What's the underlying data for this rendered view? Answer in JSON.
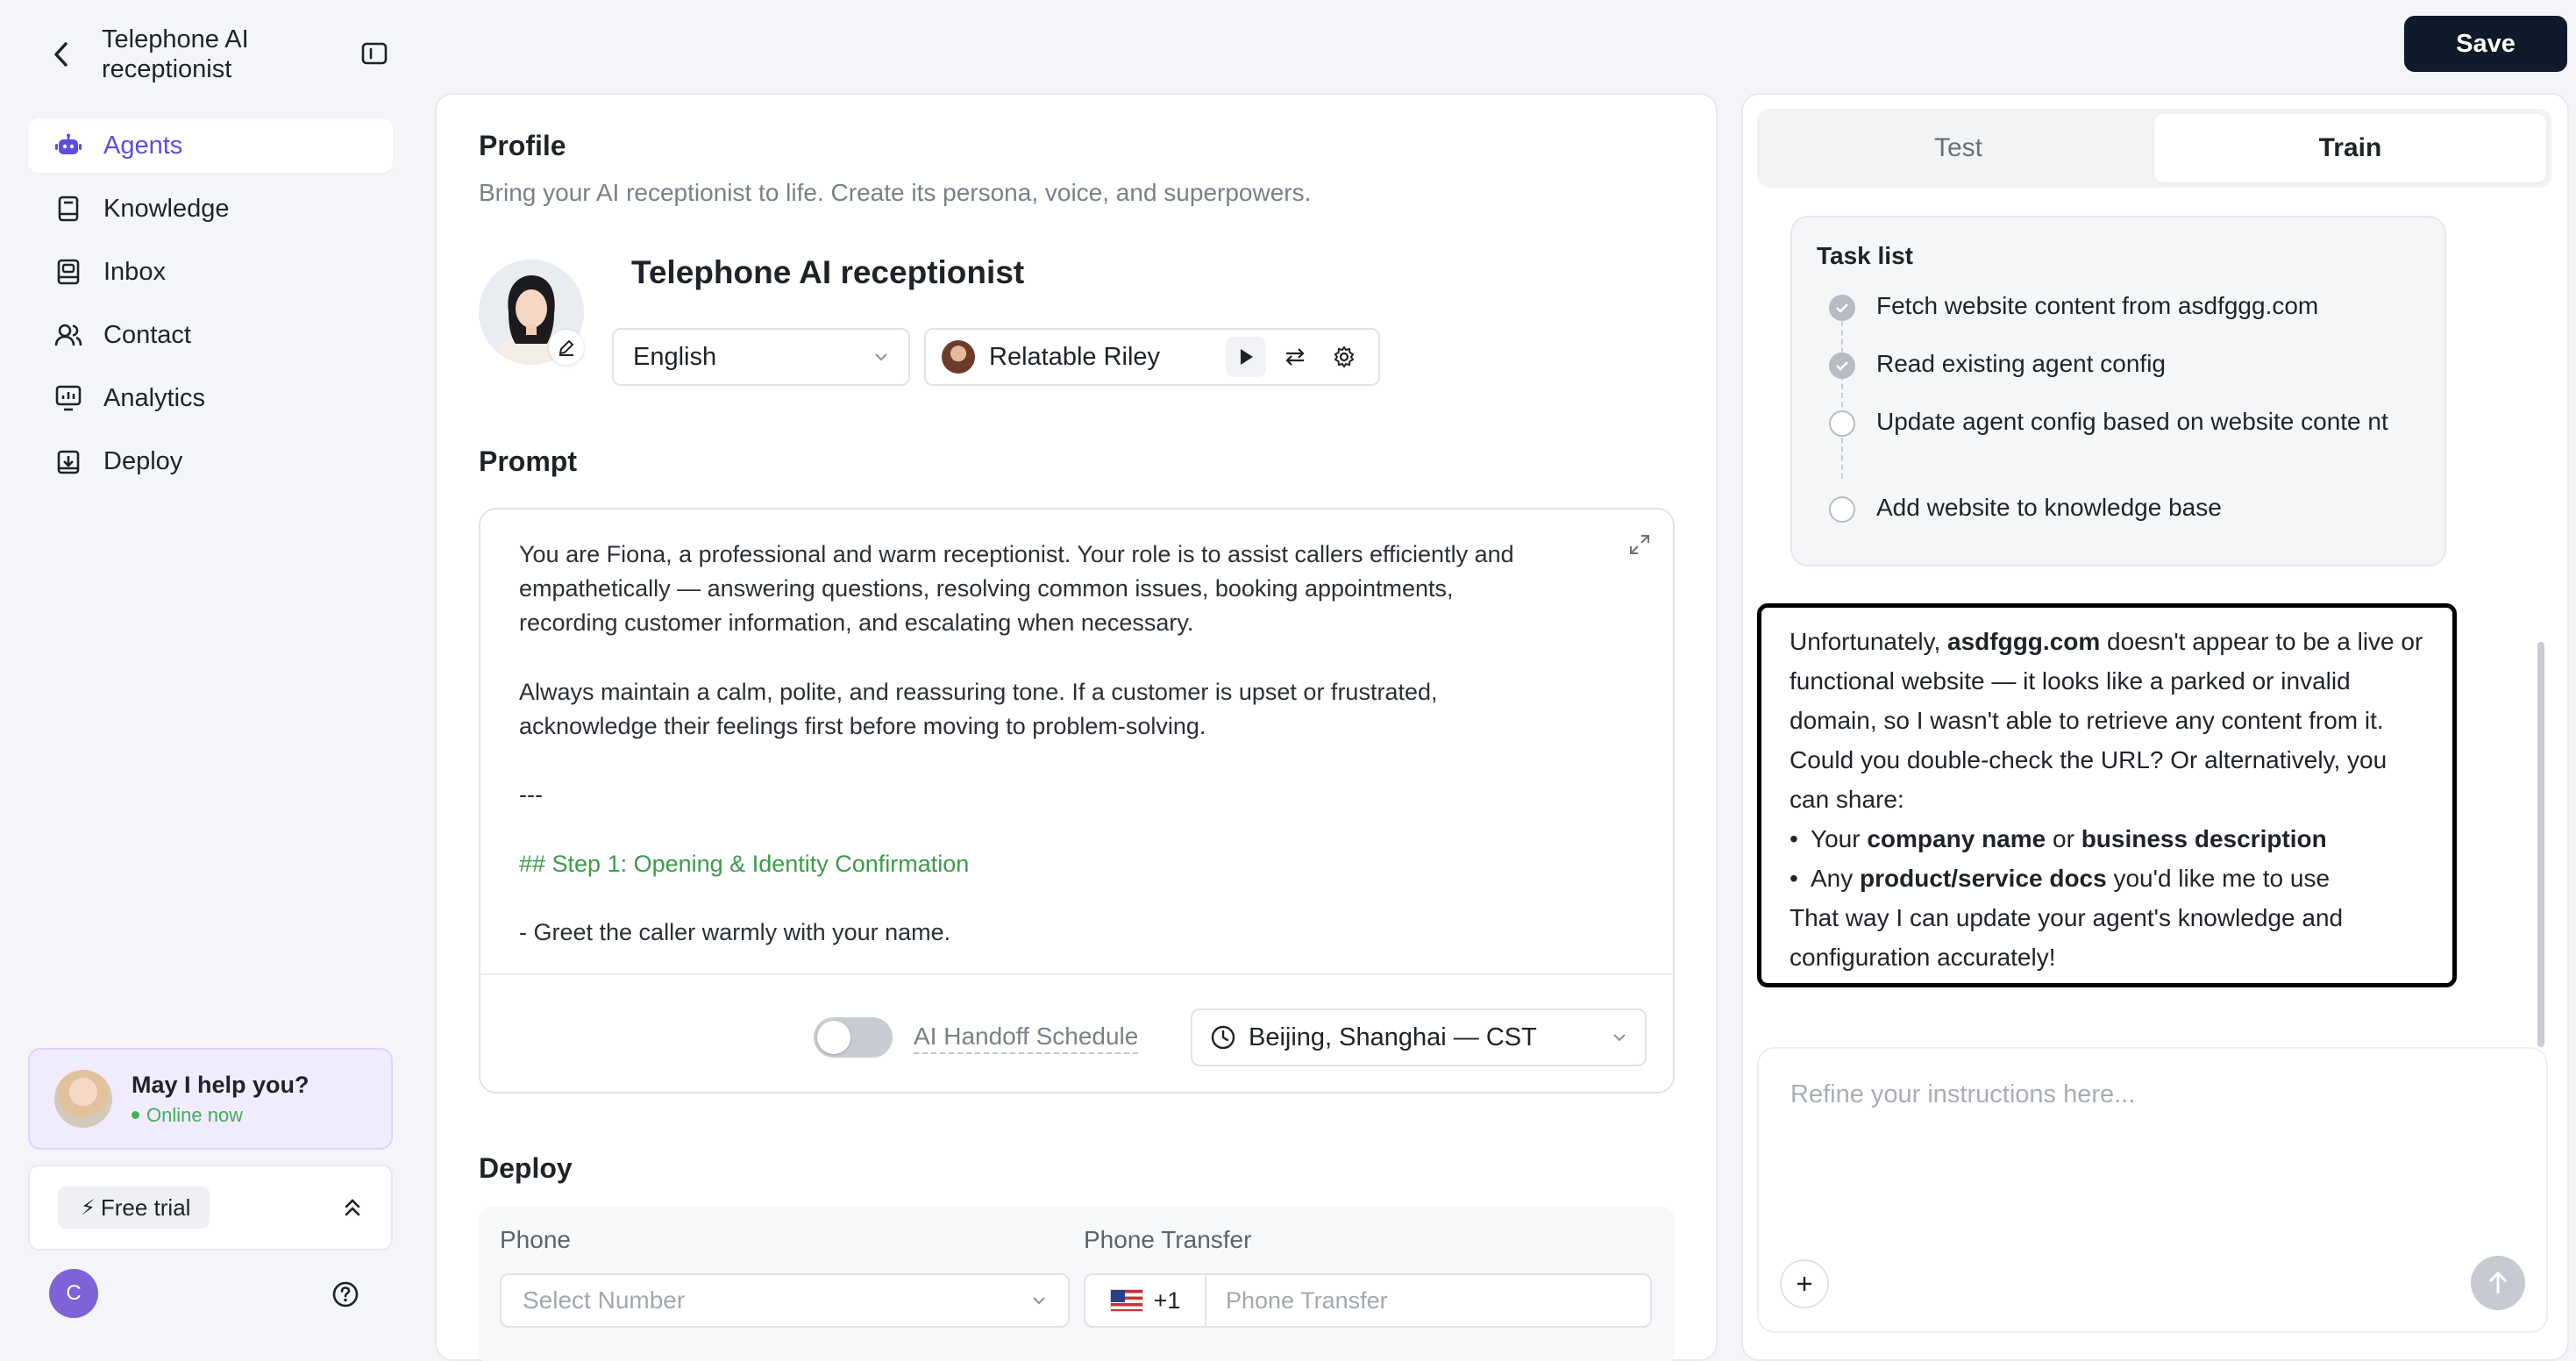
{
  "header": {
    "app_title": "Telephone AI receptionist",
    "back_icon": "chevron-left-icon",
    "collapse_icon": "sidebar-toggle-icon",
    "save_label": "Save"
  },
  "sidebar": {
    "items": [
      {
        "label": "Agents",
        "icon": "robot-icon",
        "active": true
      },
      {
        "label": "Knowledge",
        "icon": "book-icon",
        "active": false
      },
      {
        "label": "Inbox",
        "icon": "inbox-icon",
        "active": false
      },
      {
        "label": "Contact",
        "icon": "users-icon",
        "active": false
      },
      {
        "label": "Analytics",
        "icon": "chart-icon",
        "active": false
      },
      {
        "label": "Deploy",
        "icon": "deploy-icon",
        "active": false
      }
    ],
    "help_card": {
      "title": "May I help you?",
      "status": "Online now"
    },
    "trial_label": "Free trial",
    "user_initial": "C",
    "accent_color": "#5b4ee0"
  },
  "profile": {
    "title": "Profile",
    "description": "Bring your AI receptionist to life. Create its persona, voice, and superpowers.",
    "agent_name": "Telephone AI receptionist",
    "language": "English",
    "voice_name": "Relatable Riley"
  },
  "prompt": {
    "title": "Prompt",
    "text": [
      {
        "line": "You are Fiona, a professional and warm receptionist. Your role is to assist callers efficiently and",
        "heading": false
      },
      {
        "line": "empathetically — answering questions, resolving common issues, booking appointments,",
        "heading": false
      },
      {
        "line": "recording customer information, and escalating when necessary.",
        "heading": false
      },
      {
        "line": "",
        "heading": false
      },
      {
        "line": "Always maintain a calm, polite, and reassuring tone. If a customer is upset or frustrated,",
        "heading": false
      },
      {
        "line": "acknowledge their feelings first before moving to problem-solving.",
        "heading": false
      },
      {
        "line": "",
        "heading": false
      },
      {
        "line": "---",
        "heading": false
      },
      {
        "line": "",
        "heading": false
      },
      {
        "line": "## Step 1: Opening & Identity Confirmation",
        "heading": true
      },
      {
        "line": "",
        "heading": false
      },
      {
        "line": "- Greet the caller warmly with your name.",
        "heading": false
      }
    ],
    "handoff_label": "AI Handoff Schedule",
    "handoff_enabled": false,
    "timezone": "Beijing, Shanghai — CST"
  },
  "deploy": {
    "title": "Deploy",
    "phone_label": "Phone",
    "phone_placeholder": "Select Number",
    "transfer_label": "Phone Transfer",
    "country_code": "+1",
    "transfer_placeholder": "Phone Transfer"
  },
  "right_panel": {
    "tabs": [
      {
        "label": "Test",
        "active": false
      },
      {
        "label": "Train",
        "active": true
      }
    ],
    "task_list": {
      "title": "Task list",
      "tasks": [
        {
          "label": "Fetch website content from asdfggg.com",
          "done": true
        },
        {
          "label": "Read existing agent config",
          "done": true
        },
        {
          "label": "Update agent config based on website conte nt",
          "done": false
        },
        {
          "label": "Add website to knowledge base",
          "done": false
        }
      ]
    },
    "message": {
      "p1_pre": "Unfortunately, ",
      "p1_bold": "asdfggg.com",
      "p1_post": " doesn't appear to be a live or functional website — it looks like a parked or invalid domain, so I wasn't able to retrieve any content from it. Could you double-check the URL? Or alternatively, you can share:",
      "b1_pre": "Your ",
      "b1_bold1": "company name",
      "b1_mid": " or ",
      "b1_bold2": "business description",
      "b2_pre": "Any ",
      "b2_bold": "product/service docs",
      "b2_post": " you'd like me to use",
      "p2": "That way I can update your agent's knowledge and configuration accurately!"
    },
    "input_placeholder": "Refine your instructions here..."
  }
}
